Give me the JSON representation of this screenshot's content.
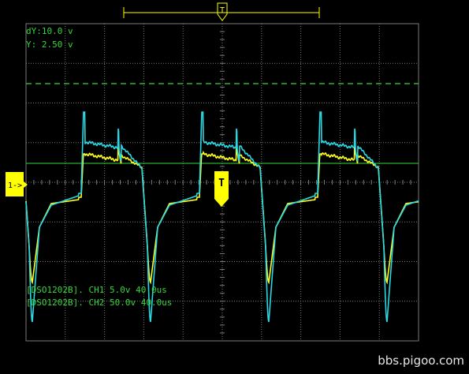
{
  "cursor_readout": {
    "dy": "dY:10.0 v",
    "y": "Y:  2.50 v"
  },
  "channel_info": [
    "[DSO1202B]. CH1 5.0v 40.0us",
    "[DSO1202B]. CH2 50.0v 40.0us"
  ],
  "trigger_marker": "T",
  "ground_marker": "1->",
  "watermark": "bbs.pigoo.com",
  "colors": {
    "background": "#000000",
    "grid": "#7a7a7a",
    "ch1": "#ffff1e",
    "ch2": "#28d9e6",
    "cursor": "#35d83a",
    "marker": "#ffff00"
  },
  "icons": {
    "trigger": "trigger-t-icon",
    "ground": "ground-arrow-icon",
    "timebase_bracket": "bracket-icon"
  }
}
